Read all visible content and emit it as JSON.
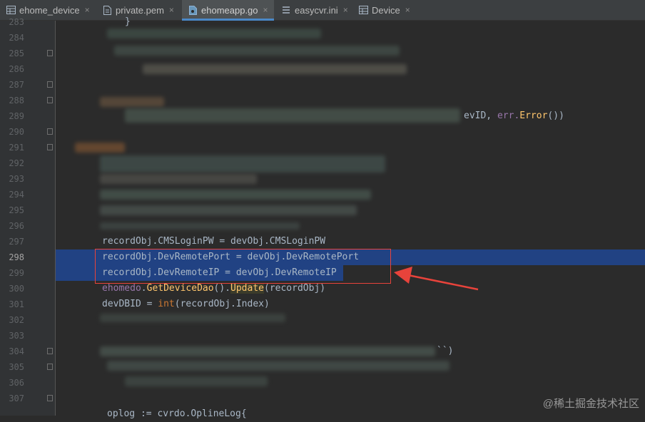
{
  "tabs": [
    {
      "label": "ehome_device",
      "icon": "table-icon",
      "close": "×"
    },
    {
      "label": "private.pem",
      "icon": "file-icon",
      "close": "×"
    },
    {
      "label": "ehomeapp.go",
      "icon": "go-file-icon",
      "close": "×",
      "active": true
    },
    {
      "label": "easycvr.ini",
      "icon": "ini-file-icon",
      "close": "×"
    },
    {
      "label": "Device",
      "icon": "table-icon",
      "close": "×"
    }
  ],
  "lines": [
    "283",
    "284",
    "285",
    "286",
    "287",
    "288",
    "289",
    "290",
    "291",
    "292",
    "293",
    "294",
    "295",
    "296",
    "297",
    "298",
    "299",
    "300",
    "301",
    "302",
    "303",
    "304",
    "305",
    "306",
    "307"
  ],
  "current_line": "298",
  "code": {
    "l283": "}",
    "l289_tail_1": "evID, ",
    "l289_tail_2": "err.",
    "l289_tail_3": "Error",
    "l289_tail_4": "())",
    "l297": "recordObj.CMSLoginPW = devObj.CMSLoginPW",
    "l298": "recordObj.DevRemotePort = devObj.DevRemotePort",
    "l299": "recordObj.DevRemoteIP = devObj.DevRemoteIP",
    "l300_pkg": "ehomedo",
    "l300_dot1": ".",
    "l300_fn1": "GetDeviceDao",
    "l300_mid": "().",
    "l300_fn2": "Update",
    "l300_arg": "(recordObj)",
    "l301_a": "devDBID = ",
    "l301_kw": "int",
    "l301_b": "(recordObj.Index)",
    "l304_tail": "``)",
    "l307": "oplog := cvrdo.OplineLog{"
  },
  "colors": {
    "selection": "#214283",
    "highlight_box": "#e8433b",
    "arrow": "#e8433b"
  },
  "watermark": "@稀土掘金技术社区"
}
